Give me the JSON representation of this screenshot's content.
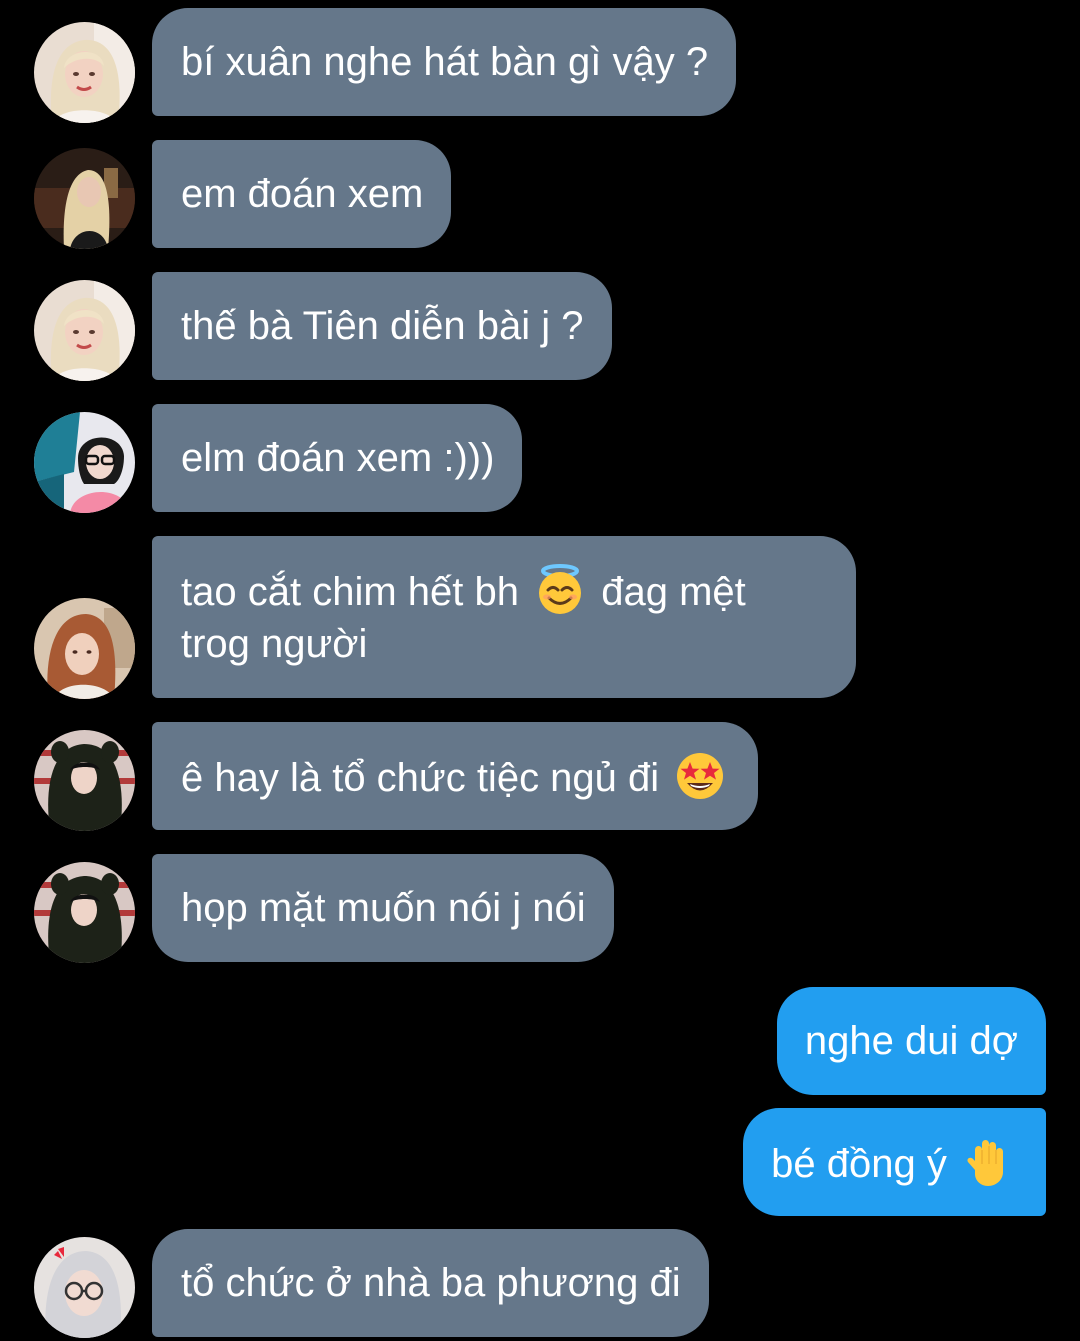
{
  "messages": [
    {
      "text": "bí xuân nghe hát bàn gì vậy ?"
    },
    {
      "text": "em đoán xem"
    },
    {
      "text": "thế bà Tiên diễn bài j ?"
    },
    {
      "text": "elm đoán xem :)))"
    },
    {
      "text_a": "tao cắt chim hết bh",
      "text_b": "đag mệt",
      "text_c": "trog người",
      "emoji": "smiling-face-with-halo-icon"
    },
    {
      "text": "ê hay là tổ chức tiệc ngủ đi",
      "emoji": "star-struck-icon"
    },
    {
      "text": "họp mặt muốn nói j nói"
    },
    {
      "text": "nghe dui dợ"
    },
    {
      "text": "bé đồng ý",
      "emoji": "raised-hand-icon"
    },
    {
      "text": "tổ chức ở nhà ba phương đi"
    }
  ],
  "colors": {
    "background": "#000000",
    "incoming_bubble": "#65778a",
    "outgoing_bubble": "#229ef0",
    "text": "#ffffff"
  }
}
